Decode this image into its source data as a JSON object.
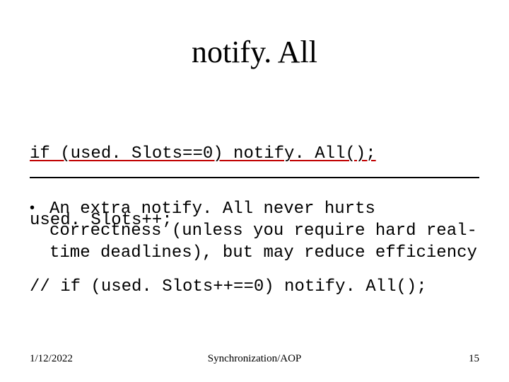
{
  "title": "notify. All",
  "code": {
    "line1": "if (used. Slots==0) notify. All();",
    "line2": "used. Slots++;",
    "line3": "// if (used. Slots++==0) notify. All();"
  },
  "bullet": {
    "mark": "•",
    "text": "An extra notify. All never hurts correctness (unless you require hard real-time deadlines), but may reduce efficiency"
  },
  "footer": {
    "date": "1/12/2022",
    "center": "Synchronization/AOP",
    "page": "15"
  }
}
